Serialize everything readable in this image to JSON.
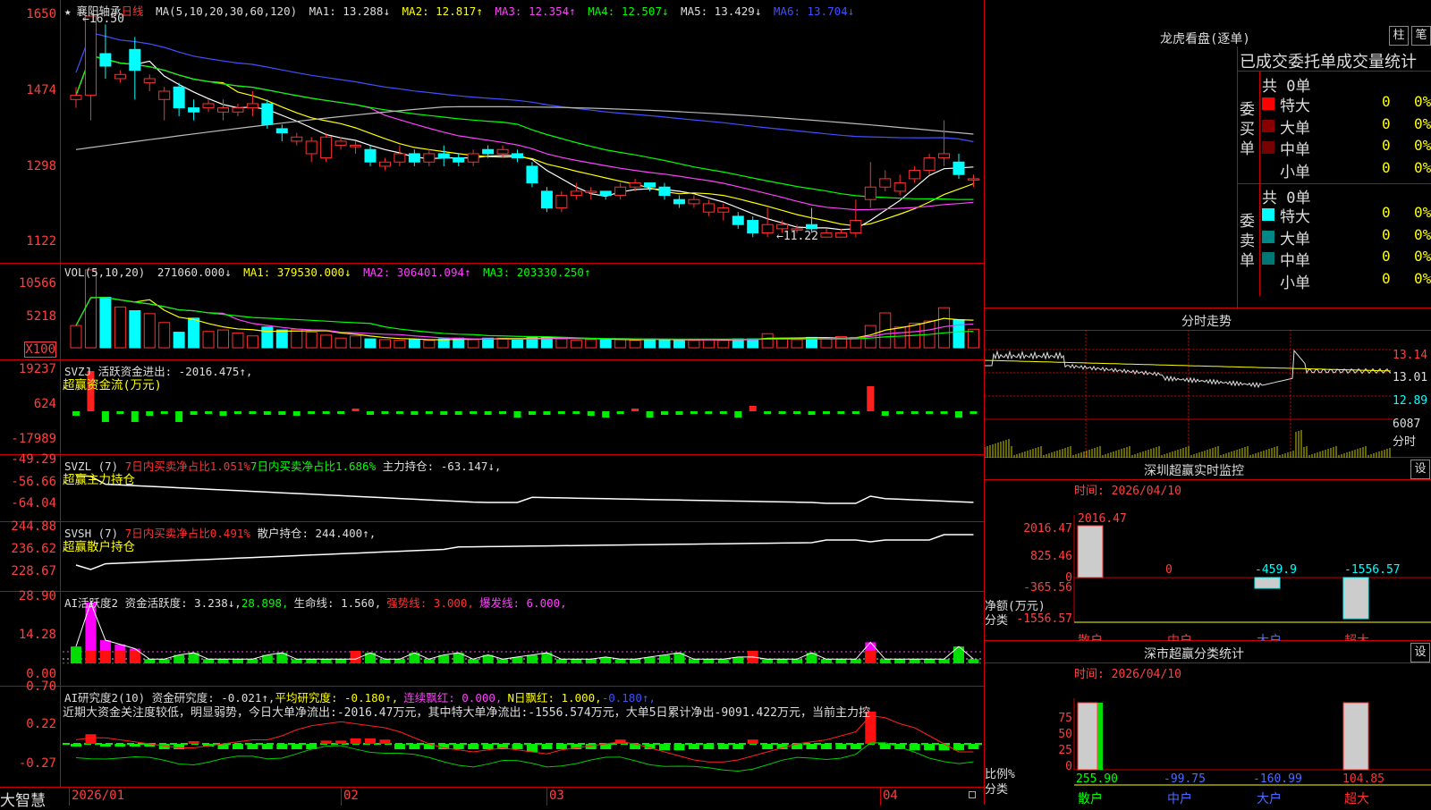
{
  "stock": {
    "name": "襄阳轴承",
    "period": "日线",
    "star": "★"
  },
  "kline": {
    "header": {
      "ma_label": "MA(5,10,20,30,60,120)",
      "ma1": "MA1: 13.288↓",
      "ma2": "MA2: 12.817↑",
      "ma3": "MA3: 12.354↑",
      "ma4": "MA4: 12.507↓",
      "ma5": "MA5: 13.429↓",
      "ma6": "MA6: 13.704↓"
    },
    "y_ticks": [
      "1650",
      "1474",
      "1298",
      "1122"
    ],
    "high_mark": "16.50",
    "low_mark": "←11.22",
    "candles": [
      [
        14.5,
        14.6,
        14.3,
        14.8
      ],
      [
        14.6,
        16.5,
        14.0,
        15.6
      ],
      [
        15.6,
        15.3,
        15.0,
        16.3
      ],
      [
        15.0,
        15.1,
        14.9,
        15.2
      ],
      [
        15.7,
        15.2,
        14.5,
        16.0
      ],
      [
        14.9,
        15.0,
        14.7,
        15.1
      ],
      [
        14.5,
        14.7,
        14.0,
        14.8
      ],
      [
        14.8,
        14.3,
        14.1,
        14.9
      ],
      [
        14.3,
        14.2,
        14.0,
        14.5
      ],
      [
        14.3,
        14.4,
        14.2,
        14.5
      ],
      [
        14.2,
        14.3,
        14.0,
        14.5
      ],
      [
        14.2,
        14.3,
        14.1,
        14.4
      ],
      [
        14.3,
        14.4,
        14.1,
        14.7
      ],
      [
        14.4,
        13.9,
        13.8,
        14.5
      ],
      [
        13.8,
        13.7,
        13.5,
        13.9
      ],
      [
        13.5,
        13.6,
        13.4,
        13.7
      ],
      [
        13.2,
        13.5,
        13.0,
        13.6
      ],
      [
        13.1,
        13.6,
        13.0,
        13.7
      ],
      [
        13.4,
        13.5,
        13.3,
        13.6
      ],
      [
        13.4,
        13.4,
        13.2,
        13.5
      ],
      [
        13.3,
        13.0,
        12.9,
        13.4
      ],
      [
        12.9,
        13.0,
        12.8,
        13.1
      ],
      [
        13.0,
        13.2,
        12.9,
        13.4
      ],
      [
        13.2,
        13.0,
        12.9,
        13.3
      ],
      [
        13.0,
        13.2,
        12.9,
        13.3
      ],
      [
        13.2,
        13.1,
        12.9,
        13.4
      ],
      [
        13.1,
        13.0,
        12.9,
        13.2
      ],
      [
        13.0,
        13.2,
        12.9,
        13.3
      ],
      [
        13.3,
        13.2,
        13.1,
        13.4
      ],
      [
        13.2,
        13.3,
        13.1,
        13.4
      ],
      [
        13.2,
        13.1,
        13.0,
        13.3
      ],
      [
        12.9,
        12.5,
        12.4,
        13.0
      ],
      [
        12.3,
        11.9,
        11.8,
        12.4
      ],
      [
        11.9,
        12.2,
        11.8,
        12.3
      ],
      [
        12.2,
        12.3,
        12.1,
        12.5
      ],
      [
        12.3,
        12.3,
        12.1,
        12.4
      ],
      [
        12.3,
        12.2,
        12.1,
        12.3
      ],
      [
        12.2,
        12.4,
        12.1,
        12.5
      ],
      [
        12.4,
        12.5,
        12.3,
        12.6
      ],
      [
        12.5,
        12.4,
        12.3,
        12.5
      ],
      [
        12.4,
        12.2,
        12.1,
        12.5
      ],
      [
        12.1,
        12.0,
        11.9,
        12.2
      ],
      [
        12.0,
        12.1,
        11.9,
        12.2
      ],
      [
        11.8,
        12.0,
        11.7,
        12.1
      ],
      [
        11.8,
        11.9,
        11.6,
        12.0
      ],
      [
        11.7,
        11.5,
        11.4,
        11.8
      ],
      [
        11.6,
        11.3,
        11.2,
        11.7
      ],
      [
        11.3,
        11.5,
        11.2,
        11.9
      ],
      [
        11.4,
        11.5,
        11.3,
        11.6
      ],
      [
        11.4,
        11.4,
        11.3,
        11.5
      ],
      [
        11.5,
        11.4,
        11.3,
        11.9
      ],
      [
        11.2,
        11.3,
        11.2,
        11.4
      ],
      [
        11.2,
        11.3,
        11.2,
        11.4
      ],
      [
        11.3,
        11.6,
        11.2,
        12.1
      ],
      [
        12.1,
        12.4,
        11.9,
        13.0
      ],
      [
        12.4,
        12.6,
        12.3,
        12.8
      ],
      [
        12.3,
        12.5,
        12.2,
        12.7
      ],
      [
        12.6,
        12.8,
        12.5,
        12.9
      ],
      [
        12.8,
        13.1,
        12.7,
        13.2
      ],
      [
        13.1,
        13.2,
        12.9,
        14.0
      ],
      [
        13.0,
        12.7,
        12.6,
        13.2
      ],
      [
        12.6,
        12.6,
        12.4,
        12.7
      ]
    ],
    "ma_colors": [
      "#ffffff",
      "#ffff00",
      "#ff40ff",
      "#00ff00",
      "#4050ff",
      "#bbbbbb"
    ]
  },
  "vol": {
    "header": {
      "label": "VOL(5,10,20)",
      "v": "271060.000↓",
      "ma1": "MA1: 379530.000↓",
      "ma2": "MA2: 306401.094↑",
      "ma3": "MA3: 203330.250↑"
    },
    "y_ticks": [
      "10566",
      "5218",
      "X100"
    ],
    "bars": [
      3,
      10.5,
      6.8,
      5.5,
      5,
      4.6,
      3.4,
      2.1,
      4,
      2.2,
      2.4,
      2,
      1.6,
      2.8,
      2.4,
      2.5,
      2.1,
      1.7,
      1.3,
      1.6,
      1.2,
      1.1,
      1.0,
      1.1,
      1.0,
      1.2,
      1.3,
      1.1,
      1.3,
      1.3,
      1.2,
      1.4,
      1.4,
      1.2,
      1.0,
      1.1,
      1.2,
      1.1,
      1.0,
      1.2,
      1.1,
      1.0,
      1.0,
      1.1,
      1.0,
      1.2,
      1.2,
      1.9,
      1.2,
      1.1,
      1.4,
      1.3,
      1.5,
      1.4,
      3.0,
      4.7,
      2.8,
      3.3,
      3.6,
      5.4,
      3.8,
      2.5
    ]
  },
  "svzj": {
    "line1": "SVZJ  活跃资金进出: -2016.475↑,",
    "line2": "超赢资金流(万元)",
    "y_ticks": [
      "19237",
      "624",
      "-17989"
    ]
  },
  "svzl": {
    "line1": "SVZL (7) ",
    "p1": "7日内买卖净占比1.051%",
    "p2": "7日内买卖净占比1.686%",
    "p3": "主力持仓: -63.147↓,",
    "line2": "超赢主力持仓",
    "y_ticks": [
      "-49.29",
      "-56.66",
      "-64.04"
    ]
  },
  "svsh": {
    "line1": "SVSH (7) ",
    "p1": "7日内买卖净占比0.491%",
    "p3": "散户持仓: 244.400↑,",
    "line2": "超赢散户持仓",
    "y_ticks": [
      "244.88",
      "236.62",
      "228.67"
    ]
  },
  "ai1": {
    "line1": "AI活跃度2 资金活跃度: 3.238↓,",
    "p1": "28.898,",
    "p2": "生命线: 1.560,",
    "p3": "强势线: 3.000,",
    "p4": "爆发线: 6.000,",
    "y_ticks": [
      "28.90",
      "14.28",
      "0.00"
    ]
  },
  "ai2": {
    "line1": "AI研究度2(10) 资金研究度: -0.021↑,",
    "p1": "平均研究度: -0.180↑,",
    "p2": "连续飘红: 0.000,",
    "p3": "N日飘红: 1.000,",
    "p4": "-0.180↑,",
    "text": "近期大资金关注度较低，明显弱势，今日大单净流出:-2016.47万元，其中特大单净流出:-1556.574万元，大单5日累计净出-9091.422万元，当前主力控",
    "y_ticks": [
      "0.70",
      "0.22",
      "-0.27"
    ]
  },
  "dates": [
    "2026/01",
    "02",
    "03",
    "04"
  ],
  "brand": "大智慧",
  "dragon": {
    "title": "龙虎看盘(逐单)",
    "btn1": "柱",
    "btn2": "笔",
    "headers": [
      "已成交",
      "委托单",
      "成交量",
      "统计"
    ],
    "buy_label": "委买单",
    "sell_label": "委卖单",
    "buy_total": "共 0单",
    "sell_total": "共 0单",
    "buy_rows": [
      [
        "特大",
        "0",
        "0%"
      ],
      [
        "大单",
        "0",
        "0%"
      ],
      [
        "中单",
        "0",
        "0%"
      ],
      [
        "小单",
        "0",
        "0%"
      ]
    ],
    "sell_rows": [
      [
        "特大",
        "0",
        "0%"
      ],
      [
        "大单",
        "0",
        "0%"
      ],
      [
        "中单",
        "0",
        "0%"
      ],
      [
        "小单",
        "0",
        "0%"
      ]
    ],
    "buy_colors": [
      "#ff0000",
      "#880000",
      "#770000",
      "#000000"
    ],
    "sell_colors": [
      "#00ffff",
      "#008888",
      "#007777",
      "#000000"
    ]
  },
  "fenshi": {
    "title": "分时走势",
    "y": [
      "13.14",
      "13.01",
      "12.89",
      "6087",
      "分时"
    ]
  },
  "sz_monitor": {
    "title": "深圳超赢实时监控",
    "btn": "设",
    "time": "时间: 2026/04/10",
    "y": [
      "2016.47",
      "825.46",
      "0",
      "-365.56",
      "-1556.57"
    ],
    "unit": "净额(万元)",
    "cat_label": "分类",
    "cats": [
      "散户",
      "中户",
      "大户",
      "超大"
    ],
    "values": [
      "2016.47",
      "0",
      "-459.9",
      "-1556.57"
    ]
  },
  "sz_class": {
    "title": "深市超赢分类统计",
    "btn": "设",
    "time": "时间: 2026/04/10",
    "y": [
      "75",
      "50",
      "25",
      "0"
    ],
    "unit": "比例%",
    "cat_label": "分类",
    "cats": [
      "散户",
      "中户",
      "大户",
      "超大"
    ],
    "values": [
      "255.90",
      "-99.75",
      "-160.99",
      "104.85"
    ]
  }
}
